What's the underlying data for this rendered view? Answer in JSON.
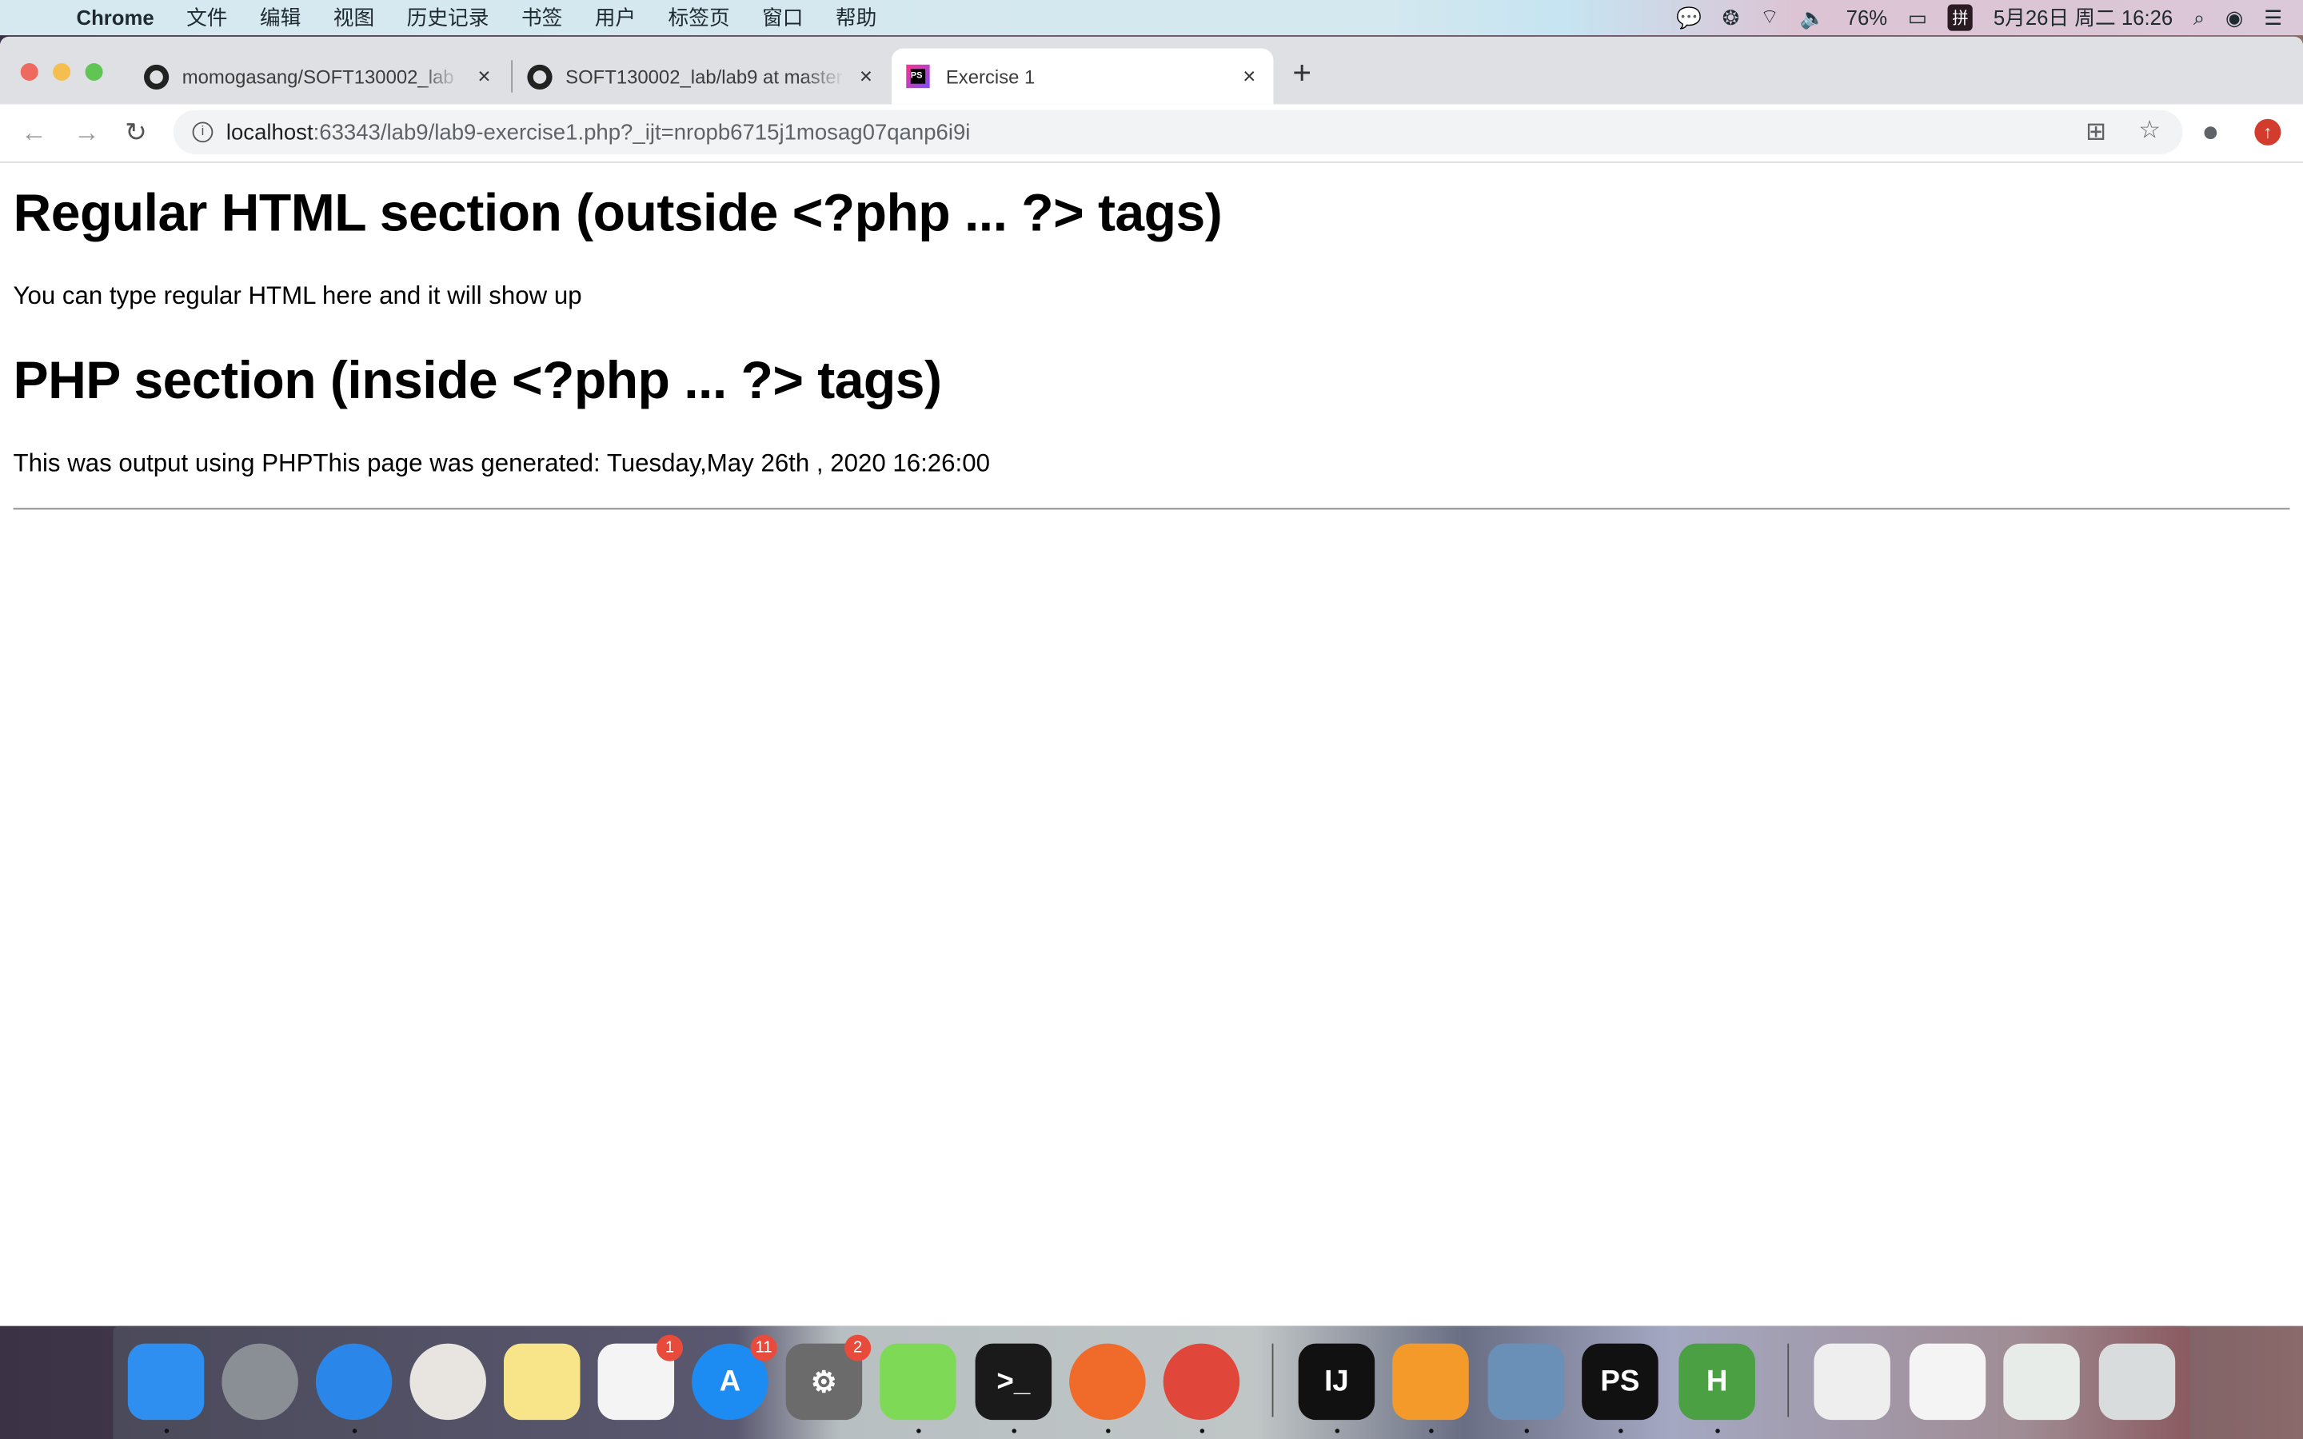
{
  "menubar": {
    "app": "Chrome",
    "items": [
      "文件",
      "编辑",
      "视图",
      "历史记录",
      "书签",
      "用户",
      "标签页",
      "窗口",
      "帮助"
    ],
    "battery": "76%",
    "ime": "拼",
    "datetime": "5月26日 周二  16:26"
  },
  "tabs": [
    {
      "title": "momogasang/SOFT130002_lab",
      "close": "×"
    },
    {
      "title": "SOFT130002_lab/lab9 at master",
      "close": "×"
    },
    {
      "title": "Exercise 1",
      "close": "×"
    }
  ],
  "newtab": "+",
  "address": {
    "host": "localhost",
    "path": ":63343/lab9/lab9-exercise1.php?_ijt=nropb6715j1mosag07qanp6i9i"
  },
  "page": {
    "h1a": "Regular HTML section (outside <?php ... ?> tags)",
    "p1": "You can type regular HTML here and it will show up",
    "h1b": "PHP section (inside <?php ... ?> tags)",
    "p2": "This was output using PHPThis page was generated: Tuesday,May 26th , 2020 16:26:00"
  },
  "dock": {
    "items": [
      {
        "name": "finder",
        "color": "#2f8ff0",
        "label": ""
      },
      {
        "name": "launchpad",
        "color": "#8a8f96",
        "label": ""
      },
      {
        "name": "safari",
        "color": "#2a86e8",
        "label": ""
      },
      {
        "name": "photos",
        "color": "#e8e4e0",
        "label": ""
      },
      {
        "name": "notes",
        "color": "#f8e58a",
        "label": ""
      },
      {
        "name": "reminders",
        "color": "#f4f4f4",
        "label": "",
        "badge": "1"
      },
      {
        "name": "app-store",
        "color": "#1d8cf2",
        "label": "A",
        "badge": "11"
      },
      {
        "name": "system-preferences",
        "color": "#6b6b6b",
        "label": "⚙",
        "badge": "2"
      },
      {
        "name": "wechat",
        "color": "#7ed957",
        "label": ""
      },
      {
        "name": "terminal",
        "color": "#1a1a1a",
        "label": ">_"
      },
      {
        "name": "firefox",
        "color": "#f06a2a",
        "label": ""
      },
      {
        "name": "chrome",
        "color": "#e0463a",
        "label": ""
      },
      {
        "name": "intellij",
        "color": "#111",
        "label": "IJ"
      },
      {
        "name": "pages",
        "color": "#f39a2a",
        "label": ""
      },
      {
        "name": "preview",
        "color": "#6b90b8",
        "label": ""
      },
      {
        "name": "phpstorm",
        "color": "#111",
        "label": "PS"
      },
      {
        "name": "hbuilder",
        "color": "#4aa043",
        "label": "H"
      },
      {
        "name": "window-1",
        "color": "#eeeeee",
        "label": ""
      },
      {
        "name": "window-2",
        "color": "#f4f4f4",
        "label": ""
      },
      {
        "name": "window-3",
        "color": "#e8ece8",
        "label": ""
      },
      {
        "name": "trash",
        "color": "#d8dcdc",
        "label": ""
      }
    ]
  }
}
